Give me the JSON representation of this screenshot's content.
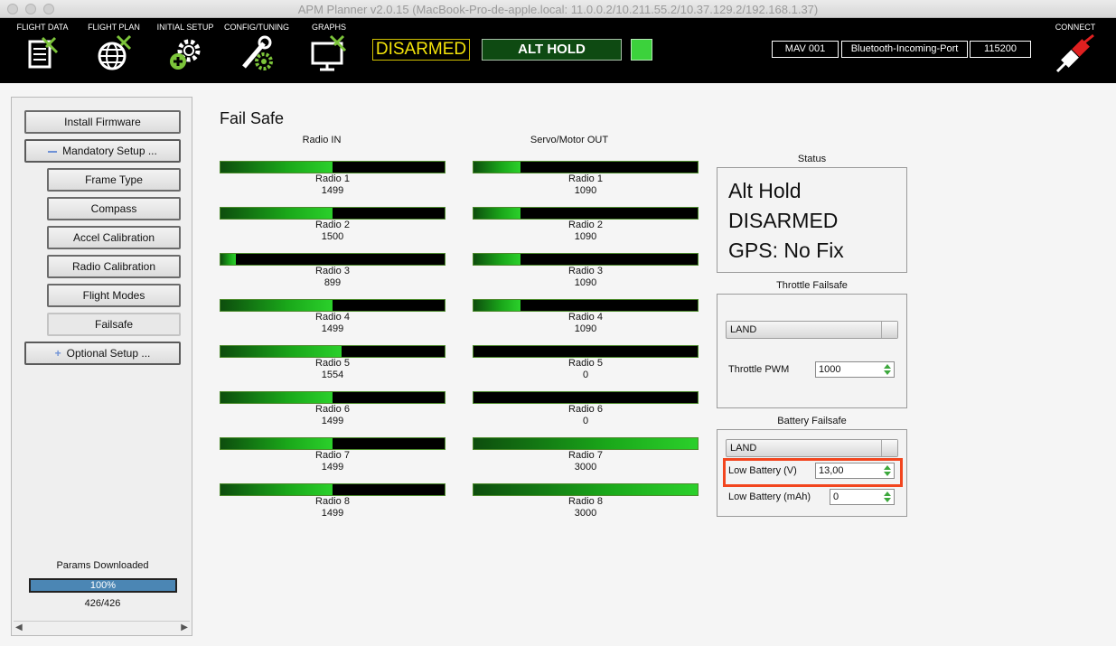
{
  "window": {
    "title": "APM Planner v2.0.15 (MacBook-Pro-de-apple.local: 11.0.0.2/10.211.55.2/10.37.129.2/192.168.1.37)"
  },
  "toolbar": {
    "flight_data": "FLIGHT DATA",
    "flight_plan": "FLIGHT PLAN",
    "initial_setup": "INITIAL SETUP",
    "config_tuning": "CONFIG/TUNING",
    "graphs": "GRAPHS",
    "arm_status": "DISARMED",
    "flight_mode": "ALT HOLD",
    "heartbeat_color": "#3cd23c",
    "mav_id": "MAV 001",
    "port": "Bluetooth-Incoming-Port",
    "baud": "115200",
    "connect": "CONNECT"
  },
  "sidebar": {
    "install_firmware": "Install Firmware",
    "mandatory_setup": "Mandatory Setup ...",
    "items": [
      {
        "label": "Frame Type"
      },
      {
        "label": "Compass"
      },
      {
        "label": "Accel Calibration"
      },
      {
        "label": "Radio Calibration"
      },
      {
        "label": "Flight Modes"
      },
      {
        "label": "Failsafe"
      }
    ],
    "optional_setup": "Optional Setup ...",
    "params_label": "Params Downloaded",
    "progress_text": "100%",
    "progress_value": 1.0,
    "params_count": "426/426"
  },
  "main": {
    "title": "Fail Safe",
    "radio_in_header": "Radio IN",
    "servo_out_header": "Servo/Motor OUT",
    "radio_in": [
      {
        "name": "Radio 1",
        "value": "1499",
        "level": 0.5
      },
      {
        "name": "Radio 2",
        "value": "1500",
        "level": 0.5
      },
      {
        "name": "Radio 3",
        "value": "899",
        "level": 0.07
      },
      {
        "name": "Radio 4",
        "value": "1499",
        "level": 0.5
      },
      {
        "name": "Radio 5",
        "value": "1554",
        "level": 0.54
      },
      {
        "name": "Radio 6",
        "value": "1499",
        "level": 0.5
      },
      {
        "name": "Radio 7",
        "value": "1499",
        "level": 0.5
      },
      {
        "name": "Radio 8",
        "value": "1499",
        "level": 0.5
      }
    ],
    "servo_out": [
      {
        "name": "Radio 1",
        "value": "1090",
        "level": 0.21
      },
      {
        "name": "Radio 2",
        "value": "1090",
        "level": 0.21
      },
      {
        "name": "Radio 3",
        "value": "1090",
        "level": 0.21
      },
      {
        "name": "Radio 4",
        "value": "1090",
        "level": 0.21
      },
      {
        "name": "Radio 5",
        "value": "0",
        "level": 0
      },
      {
        "name": "Radio 6",
        "value": "0",
        "level": 0
      },
      {
        "name": "Radio 7",
        "value": "3000",
        "level": 1.0
      },
      {
        "name": "Radio 8",
        "value": "3000",
        "level": 1.0
      }
    ]
  },
  "status": {
    "title": "Status",
    "mode": "Alt Hold",
    "armed": "DISARMED",
    "gps": "GPS: No Fix"
  },
  "throttle": {
    "title": "Throttle Failsafe",
    "action": "LAND",
    "pwm_label": "Throttle PWM",
    "pwm_value": "1000"
  },
  "battery": {
    "title": "Battery Failsafe",
    "action": "LAND",
    "low_v_label": "Low Battery (V)",
    "low_v_value": "13,00",
    "low_mah_label": "Low Battery (mAh)",
    "low_mah_value": "0"
  }
}
